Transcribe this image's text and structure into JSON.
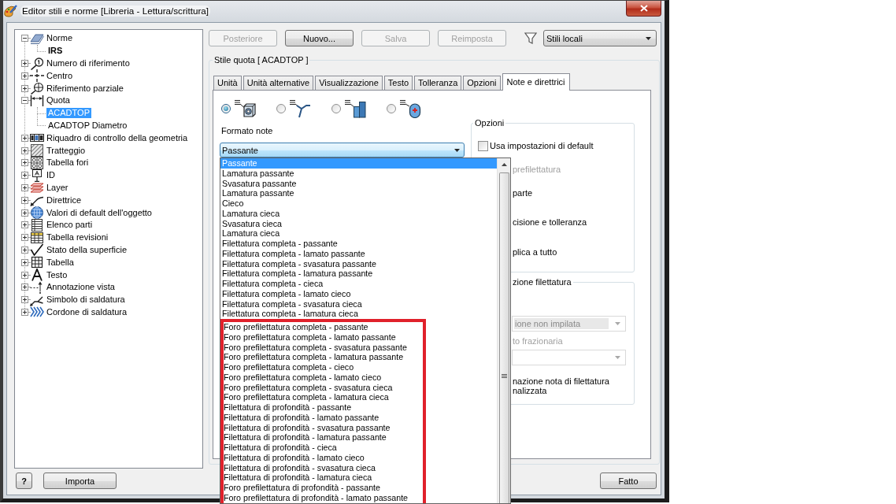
{
  "window": {
    "title": "Editor stili e norme [Libreria - Lettura/scrittura]"
  },
  "tree": [
    {
      "label": "Norme",
      "kind": "standard",
      "expanded": true,
      "selected": false,
      "children": [
        {
          "label": "IRS",
          "selected": false,
          "active": true
        }
      ]
    },
    {
      "label": "Numero di riferimento",
      "kind": "balloon",
      "expanded": false,
      "selected": false
    },
    {
      "label": "Centro",
      "kind": "center-mark",
      "expanded": false,
      "selected": false
    },
    {
      "label": "Riferimento parziale",
      "kind": "datum",
      "expanded": false,
      "selected": false
    },
    {
      "label": "Quota",
      "kind": "dimension",
      "expanded": true,
      "selected": false,
      "children": [
        {
          "label": "ACADTOP",
          "selected": true,
          "active": false
        },
        {
          "label": "ACADTOP Diametro",
          "selected": false,
          "active": false
        }
      ]
    },
    {
      "label": "Riquadro di controllo della geometria",
      "kind": "feature-frame",
      "expanded": false,
      "selected": false
    },
    {
      "label": "Tratteggio",
      "kind": "hatch",
      "expanded": false,
      "selected": false
    },
    {
      "label": "Tabella fori",
      "kind": "hole-table",
      "expanded": false,
      "selected": false
    },
    {
      "label": "ID",
      "kind": "id",
      "expanded": false,
      "selected": false
    },
    {
      "label": "Layer",
      "kind": "layer",
      "expanded": false,
      "selected": false
    },
    {
      "label": "Direttrice",
      "kind": "leader",
      "expanded": false,
      "selected": false
    },
    {
      "label": "Valori di default dell'oggetto",
      "kind": "object-defaults",
      "expanded": false,
      "selected": false
    },
    {
      "label": "Elenco parti",
      "kind": "parts-list",
      "expanded": false,
      "selected": false
    },
    {
      "label": "Tabella revisioni",
      "kind": "revision-table",
      "expanded": false,
      "selected": false
    },
    {
      "label": "Stato della superficie",
      "kind": "surface",
      "expanded": false,
      "selected": false
    },
    {
      "label": "Tabella",
      "kind": "table",
      "expanded": false,
      "selected": false
    },
    {
      "label": "Testo",
      "kind": "text",
      "expanded": false,
      "selected": false
    },
    {
      "label": "Annotazione vista",
      "kind": "view-annotation",
      "expanded": false,
      "selected": false
    },
    {
      "label": "Simbolo di saldatura",
      "kind": "weld-symbol",
      "expanded": false,
      "selected": false
    },
    {
      "label": "Cordone di saldatura",
      "kind": "weld-bead",
      "expanded": false,
      "selected": false
    }
  ],
  "toolbar": {
    "buttons": [
      {
        "label": "Posteriore",
        "disabled": true
      },
      {
        "label": "Nuovo...",
        "disabled": false
      },
      {
        "label": "Salva",
        "disabled": true
      },
      {
        "label": "Reimposta",
        "disabled": true
      }
    ],
    "filter": {
      "value": "Stili locali"
    }
  },
  "style_group": {
    "title": "Stile quota [ ACADTOP ]"
  },
  "tabs": [
    {
      "label": "Unità",
      "selected": false
    },
    {
      "label": "Unità alternative",
      "selected": false
    },
    {
      "label": "Visualizzazione",
      "selected": false
    },
    {
      "label": "Testo",
      "selected": false
    },
    {
      "label": "Tolleranza",
      "selected": false
    },
    {
      "label": "Opzioni",
      "selected": false
    },
    {
      "label": "Note e direttrici",
      "selected": true
    }
  ],
  "note_types": [
    {
      "kind": "hole",
      "selected": true
    },
    {
      "kind": "bend",
      "selected": false
    },
    {
      "kind": "block",
      "selected": false
    },
    {
      "kind": "capsule",
      "selected": false
    }
  ],
  "note_format": {
    "label": "Formato note",
    "value": "Passante",
    "options": [
      {
        "label": "Passante",
        "selected": true
      },
      {
        "label": "Lamatura passante",
        "selected": false
      },
      {
        "label": "Svasatura passante",
        "selected": false
      },
      {
        "label": "Lamatura passante",
        "selected": false
      },
      {
        "label": "Cieco",
        "selected": false
      },
      {
        "label": "Lamatura cieca",
        "selected": false
      },
      {
        "label": "Svasatura cieca",
        "selected": false
      },
      {
        "label": "Lamatura cieca",
        "selected": false
      },
      {
        "label": "Filettatura completa - passante",
        "selected": false
      },
      {
        "label": "Filettatura completa - lamato passante",
        "selected": false
      },
      {
        "label": "Filettatura completa - svasatura passante",
        "selected": false
      },
      {
        "label": "Filettatura completa - lamatura passante",
        "selected": false
      },
      {
        "label": "Filettatura completa - cieca",
        "selected": false
      },
      {
        "label": "Filettatura completa - lamato cieco",
        "selected": false
      },
      {
        "label": "Filettatura completa - svasatura cieca",
        "selected": false
      },
      {
        "label": "Filettatura completa - lamatura cieca",
        "selected": false
      }
    ],
    "highlighted_options": [
      {
        "label": "Foro prefilettatura completa - passante",
        "selected": false
      },
      {
        "label": "Foro prefilettatura completa - lamato passante",
        "selected": false
      },
      {
        "label": "Foro prefilettatura completa - svasatura passante",
        "selected": false
      },
      {
        "label": "Foro prefilettatura completa - lamatura passante",
        "selected": false
      },
      {
        "label": "Foro prefilettatura completa - cieco",
        "selected": false
      },
      {
        "label": "Foro prefilettatura completa - lamato cieco",
        "selected": false
      },
      {
        "label": "Foro prefilettatura completa - svasatura cieca",
        "selected": false
      },
      {
        "label": "Foro prefilettatura completa - lamatura cieca",
        "selected": false
      },
      {
        "label": "Filettatura di profondità - passante",
        "selected": false
      },
      {
        "label": "Filettatura di profondità - lamato passante",
        "selected": false
      },
      {
        "label": "Filettatura di profondità - svasatura passante",
        "selected": false
      },
      {
        "label": "Filettatura di profondità - lamatura passante",
        "selected": false
      },
      {
        "label": "Filettatura di profondità - cieca",
        "selected": false
      },
      {
        "label": "Filettatura di profondità - lamato cieco",
        "selected": false
      },
      {
        "label": "Filettatura di profondità - svasatura cieca",
        "selected": false
      },
      {
        "label": "Filettatura di profondità - lamatura cieca",
        "selected": false
      },
      {
        "label": "Foro prefilettatura di profondità - passante",
        "selected": false
      },
      {
        "label": "Foro prefilettatura di profondità - lamato passante",
        "selected": false
      }
    ]
  },
  "options": {
    "title": "Opzioni",
    "rows": [
      {
        "kind": "checkbox",
        "label": "Usa impostazioni di default",
        "checked": false
      },
      {
        "kind": "text",
        "label": "prefilettatura",
        "disabled": true
      },
      {
        "kind": "text",
        "label": "parte",
        "disabled": false
      },
      {
        "kind": "text",
        "label": "cisione e tolleranza",
        "disabled": false
      },
      {
        "kind": "text",
        "label": "plica a tutto",
        "disabled": false
      }
    ]
  },
  "thread_group": {
    "title": "zione filettatura",
    "rows": [
      {
        "kind": "select",
        "value": "ione non impilata",
        "disabled": true
      },
      {
        "kind": "text",
        "label": "to frazionaria",
        "disabled": true
      },
      {
        "kind": "select",
        "disabled": true
      },
      {
        "kind": "text",
        "label": "nazione nota di filettatura nalizzata",
        "disabled": false
      }
    ]
  },
  "footer": {
    "help_button": "?",
    "import_button": "Importa",
    "done_button": "Fatto"
  }
}
